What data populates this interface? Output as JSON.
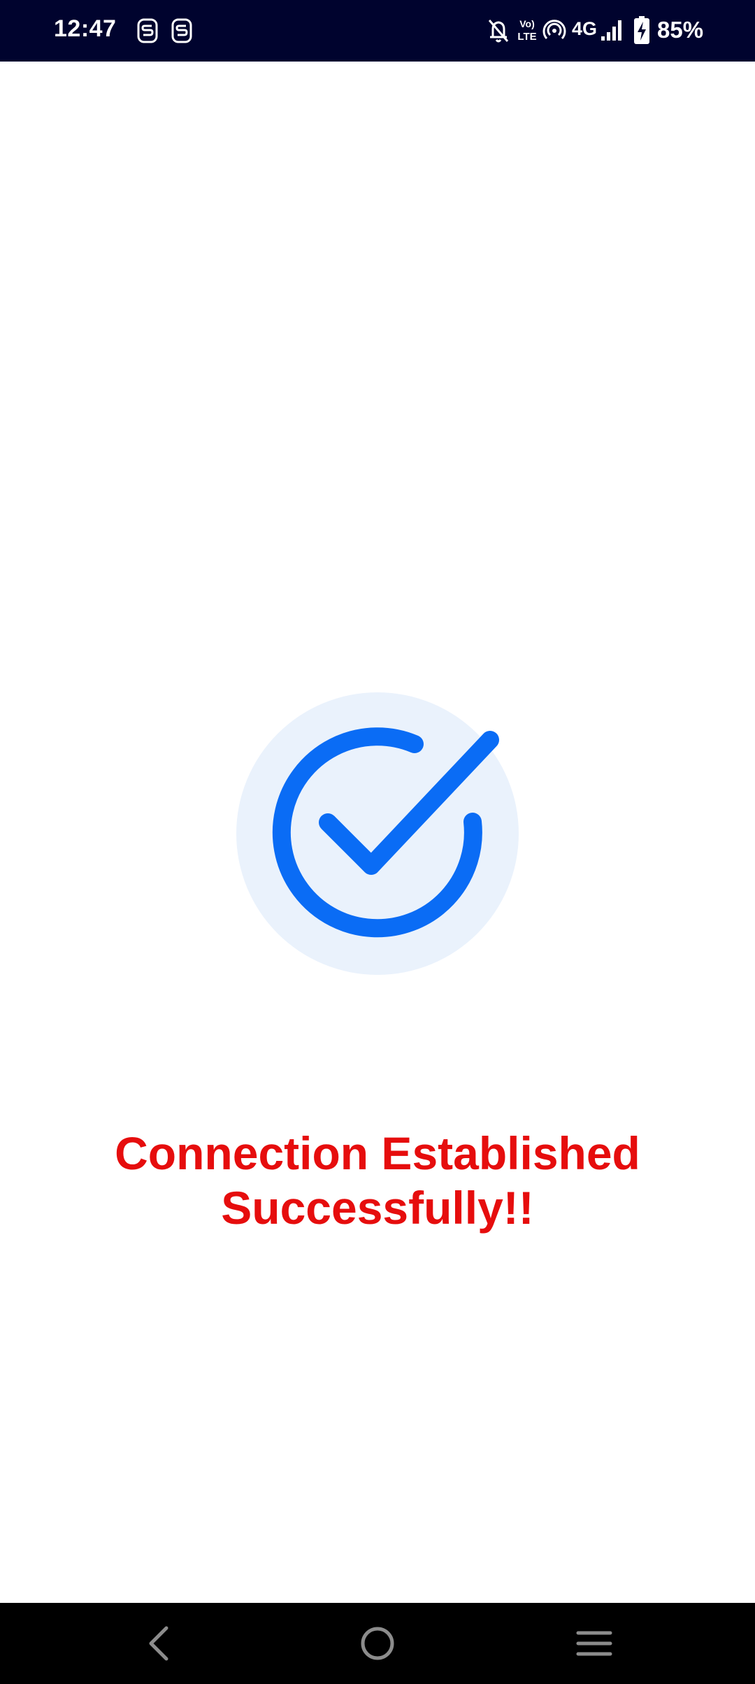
{
  "status_bar": {
    "time": "12:47",
    "network": "4G",
    "battery_percent": "85%",
    "battery_level": 0.85,
    "icons": [
      "notification-s-icon",
      "notification-s-icon",
      "bell-off-icon",
      "volte-icon",
      "hotspot-icon",
      "signal-icon",
      "battery-charging-icon"
    ]
  },
  "main": {
    "message": "Connection Established Successfully!!",
    "badge_icon": "check-circle-icon"
  },
  "nav_bar": {
    "icons": [
      "back-icon",
      "home-icon",
      "recents-menu-icon"
    ]
  },
  "colors": {
    "status_bar_bg": "#00032e",
    "accent_blue": "#0a6cf5",
    "badge_bg": "#eaf2fc",
    "message_red": "#e60d0d",
    "nav_bar_bg": "#000000"
  }
}
